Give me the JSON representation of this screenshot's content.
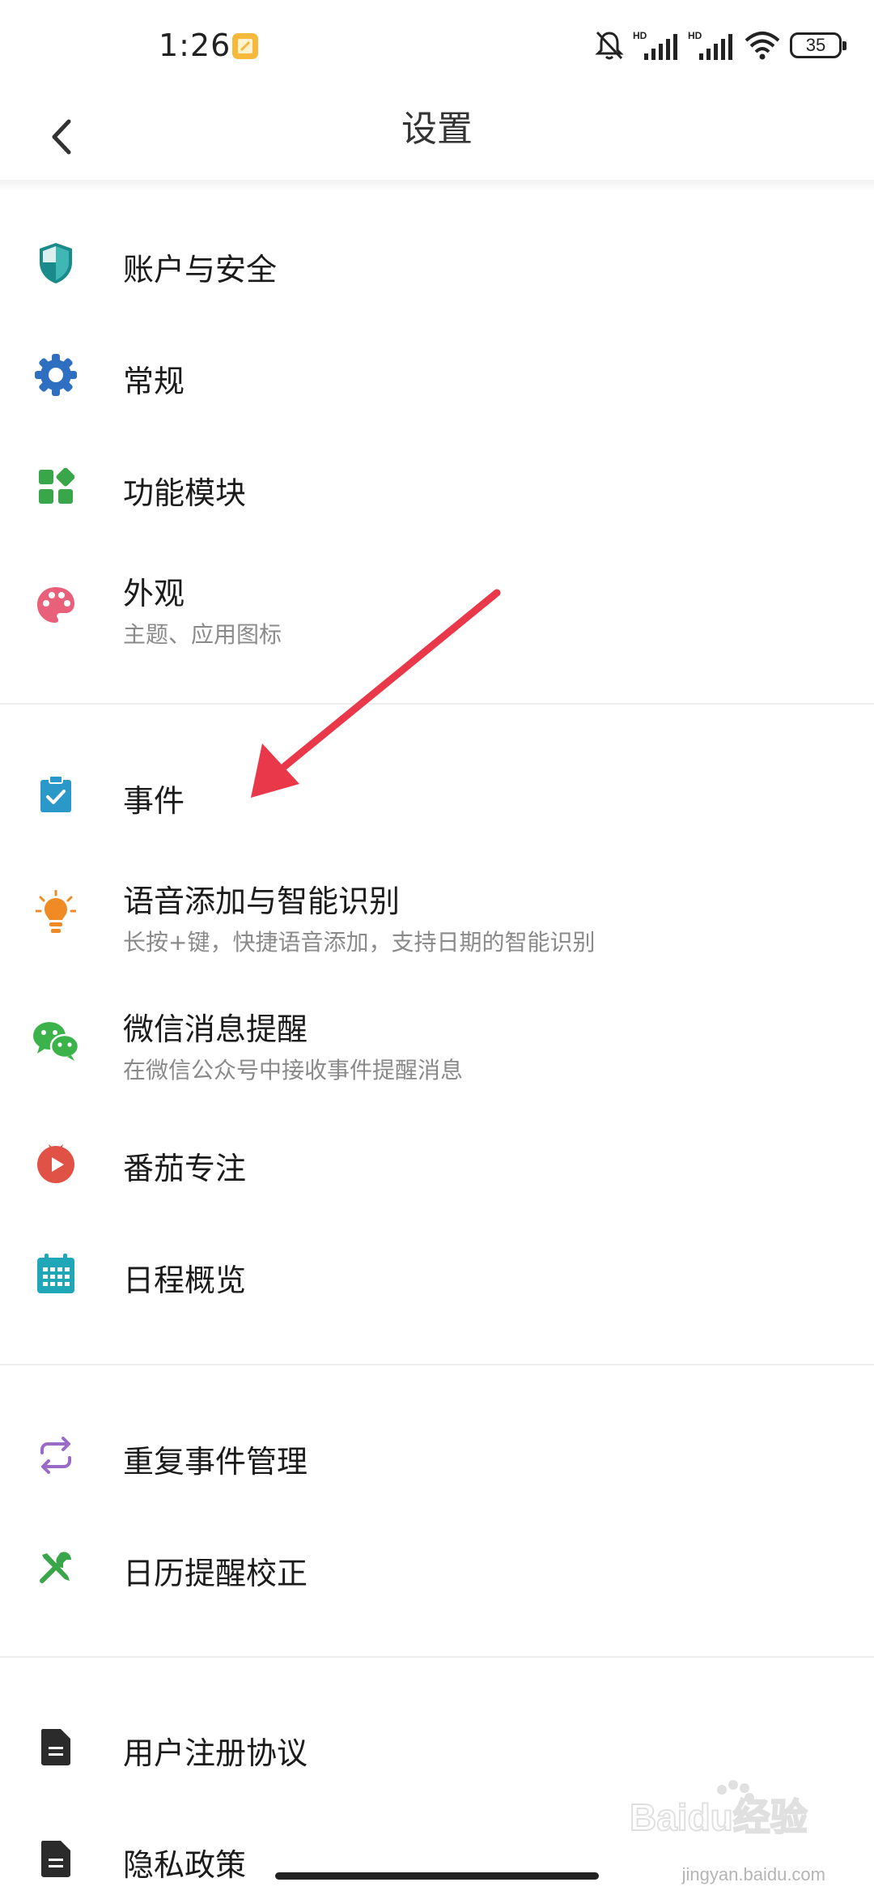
{
  "status_bar": {
    "time": "1:26",
    "network_1": "HD",
    "network_2": "HD",
    "battery": "35"
  },
  "header": {
    "title": "设置"
  },
  "sections": [
    {
      "items": [
        {
          "label": "账户与安全",
          "icon": "shield-icon",
          "color": "#1a8a8a"
        },
        {
          "label": "常规",
          "icon": "gear-icon",
          "color": "#2f6fc2"
        },
        {
          "label": "功能模块",
          "icon": "modules-icon",
          "color": "#3aa64a"
        },
        {
          "label": "外观",
          "sub": "主题、应用图标",
          "icon": "palette-icon",
          "color": "#e8607a"
        }
      ]
    },
    {
      "items": [
        {
          "label": "事件",
          "icon": "clipboard-check-icon",
          "color": "#2a98c9"
        },
        {
          "label": "语音添加与智能识别",
          "sub": "长按+键，快捷语音添加，支持日期的智能识别",
          "icon": "lightbulb-icon",
          "color": "#f08a25"
        },
        {
          "label": "微信消息提醒",
          "sub": "在微信公众号中接收事件提醒消息",
          "icon": "wechat-icon",
          "color": "#3bb34a"
        },
        {
          "label": "番茄专注",
          "icon": "tomato-icon",
          "color": "#e05245"
        },
        {
          "label": "日程概览",
          "icon": "calendar-icon",
          "color": "#1fa7b8"
        }
      ]
    },
    {
      "items": [
        {
          "label": "重复事件管理",
          "icon": "repeat-icon",
          "color": "#9b6ac6"
        },
        {
          "label": "日历提醒校正",
          "icon": "tools-icon",
          "color": "#3aa64a"
        }
      ]
    },
    {
      "items": [
        {
          "label": "用户注册协议",
          "icon": "document-icon",
          "color": "#2b2b2b"
        },
        {
          "label": "隐私政策",
          "icon": "document-icon",
          "color": "#2b2b2b"
        }
      ]
    }
  ],
  "annotation": {
    "color": "#e8384a"
  },
  "watermark": {
    "text": "Baidu经验",
    "sub": "jingyan.baidu.com"
  }
}
